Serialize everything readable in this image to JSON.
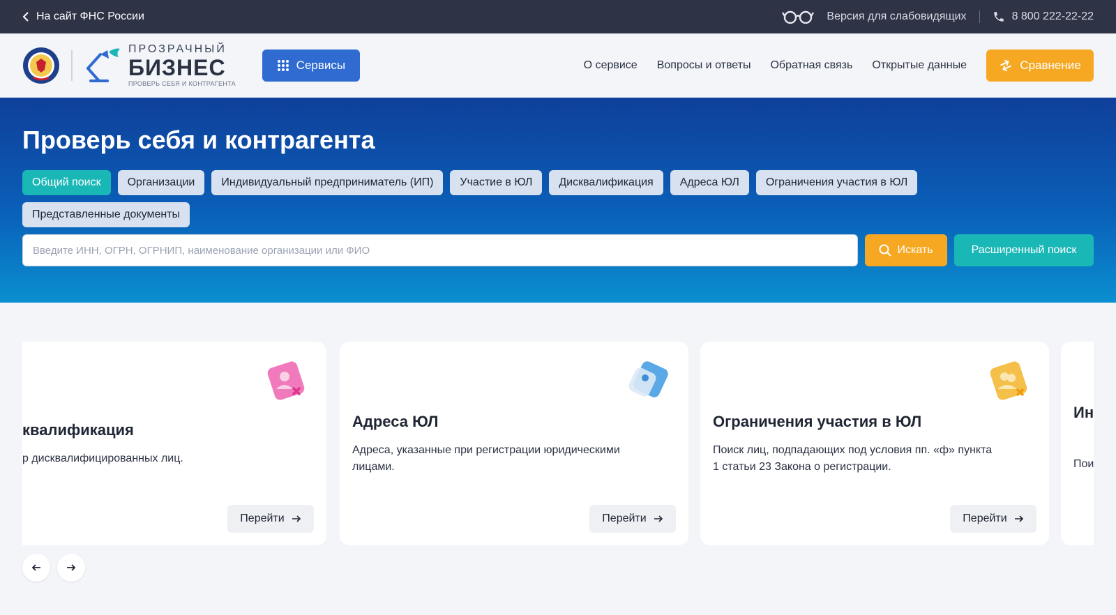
{
  "topbar": {
    "back_link": "На сайт ФНС России",
    "vision_label": "Версия для слабовидящих",
    "phone": "8 800 222-22-22"
  },
  "header": {
    "brand_top": "ПРОЗРАЧНЫЙ",
    "brand_main": "БИЗНЕС",
    "brand_sub": "ПРОВЕРЬ СЕБЯ И КОНТРАГЕНТА",
    "services_label": "Сервисы",
    "nav": [
      "О сервисе",
      "Вопросы и ответы",
      "Обратная связь",
      "Открытые данные"
    ],
    "compare_label": "Сравнение"
  },
  "hero": {
    "title": "Проверь себя и контрагента",
    "tabs": [
      {
        "label": "Общий поиск",
        "active": true
      },
      {
        "label": "Организации",
        "active": false
      },
      {
        "label": "Индивидуальный предприниматель (ИП)",
        "active": false
      },
      {
        "label": "Участие в ЮЛ",
        "active": false
      },
      {
        "label": "Дисквалификация",
        "active": false
      },
      {
        "label": "Адреса ЮЛ",
        "active": false
      },
      {
        "label": "Ограничения участия в ЮЛ",
        "active": false
      },
      {
        "label": "Представленные документы",
        "active": false
      }
    ],
    "search_placeholder": "Введите ИНН, ОГРН, ОГРНИП, наименование организации или ФИО",
    "search_value": "",
    "search_button": "Искать",
    "advanced_button": "Расширенный поиск"
  },
  "cards": [
    {
      "title": "квалификация",
      "desc": "р дисквалифицированных лиц.",
      "button": "Перейти",
      "icon": "user-x-icon",
      "color": "#e94a9c"
    },
    {
      "title": "Адреса ЮЛ",
      "desc": "Адреса, указанные при регистрации юридическими лицами.",
      "button": "Перейти",
      "icon": "location-icon",
      "color": "#2f8fd8"
    },
    {
      "title": "Ограничения участия в ЮЛ",
      "desc": "Поиск лиц, подпадающих под условия пп. «ф» пункта 1 статьи 23 Закона о регистрации.",
      "button": "Перейти",
      "icon": "users-x-icon",
      "color": "#f2b01e"
    },
    {
      "title": "Ин до",
      "desc": "Пои пре",
      "button": "",
      "icon": "",
      "color": ""
    }
  ],
  "colors": {
    "topbar_bg": "#2e3346",
    "primary_blue": "#2f6bd1",
    "accent_orange": "#f7a823",
    "accent_teal": "#1ab7b7"
  }
}
